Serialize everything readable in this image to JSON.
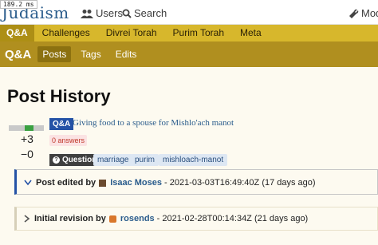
{
  "perf": "189.2 ms",
  "site": {
    "logo_text": "Judaism"
  },
  "header": {
    "users_label": "Users",
    "search_label": "Search",
    "mod_label": "Mod"
  },
  "categories": [
    {
      "label": "Q&A",
      "active": true
    },
    {
      "label": "Challenges"
    },
    {
      "label": "Divrei Torah"
    },
    {
      "label": "Purim Torah"
    },
    {
      "label": "Meta"
    }
  ],
  "subnav": {
    "title": "Q&A",
    "tabs": [
      "Posts",
      "Tags",
      "Edits"
    ]
  },
  "page": {
    "title": "Post History"
  },
  "post": {
    "category_badge": "Q&A",
    "title": "Giving food to a spouse for Mishlo'ach manot",
    "score_up": "+3",
    "score_down": "−0",
    "answers": "0 answers",
    "post_type": "Question",
    "tags": [
      "marriage",
      "purim",
      "mishloach-manot"
    ]
  },
  "revisions": [
    {
      "action": "Post edited by",
      "user": "Isaac Moses",
      "timestamp": "- 2021-03-03T16:49:40Z (17 days ago)"
    },
    {
      "action": "Initial revision by",
      "user": "rosends",
      "timestamp": "- 2021-02-28T00:14:34Z (21 days ago)"
    }
  ],
  "colors": {
    "brand_blue": "#2452a6",
    "gold": "#d7b72c",
    "dark_gold": "#b08f1f"
  }
}
